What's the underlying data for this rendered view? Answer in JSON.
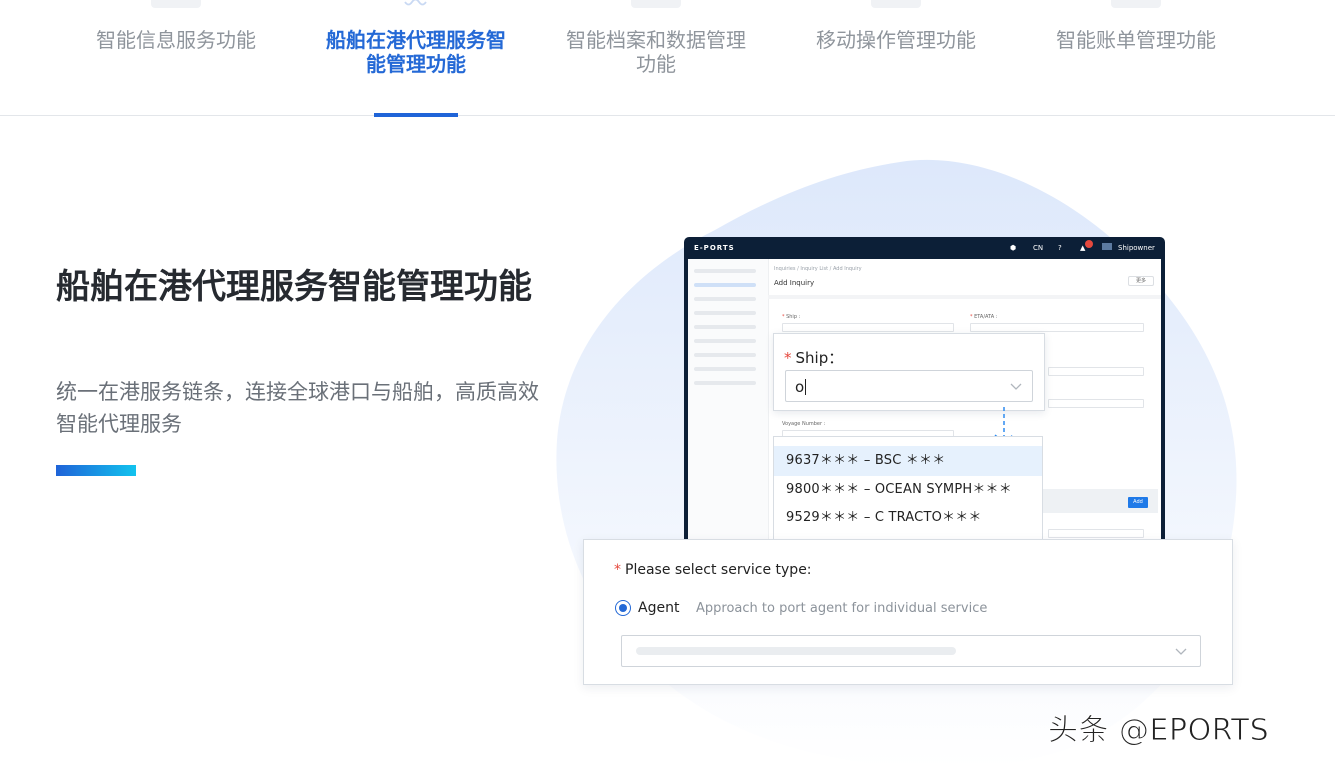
{
  "tabs": [
    {
      "label": "智能信息服务功能",
      "active": false
    },
    {
      "label": "船舶在港代理服务智能管理功能",
      "active": true
    },
    {
      "label": "智能档案和数据管理功能",
      "active": false
    },
    {
      "label": "移动操作管理功能",
      "active": false
    },
    {
      "label": "智能账单管理功能",
      "active": false
    }
  ],
  "hero": {
    "title": "船舶在港代理服务智能管理功能",
    "subtitle": "统一在港服务链条，连接全球港口与船舶，高质高效智能代理服务"
  },
  "app": {
    "logo": "E-PORTS",
    "lang": "CN",
    "notification_count": "5",
    "user": "Shipowner",
    "breadcrumb": "Inquiries / Inquiry List / Add Inquiry",
    "page_title": "Add Inquiry",
    "more_label": "更多",
    "ship_field_label": "Ship :",
    "eta_field_label": "ETA/ATA :",
    "voyage_label": "Voyage Number :",
    "add_button": "Add"
  },
  "ship_popup": {
    "label": "Ship：",
    "value": "o"
  },
  "suggestions": [
    "9637＊＊＊ – BSC ＊＊＊",
    "9800＊＊＊ – OCEAN SYMPH＊＊＊",
    "9529＊＊＊ – C TRACTO＊＊＊"
  ],
  "service": {
    "label": "Please select service type:",
    "option_label": "Agent",
    "option_desc": "Approach to port agent for individual service"
  },
  "watermark": "头条 @EPORTS",
  "colors": {
    "accent": "#2469d6",
    "required_star": "#e5483d",
    "app_dark": "#0c1f37"
  }
}
